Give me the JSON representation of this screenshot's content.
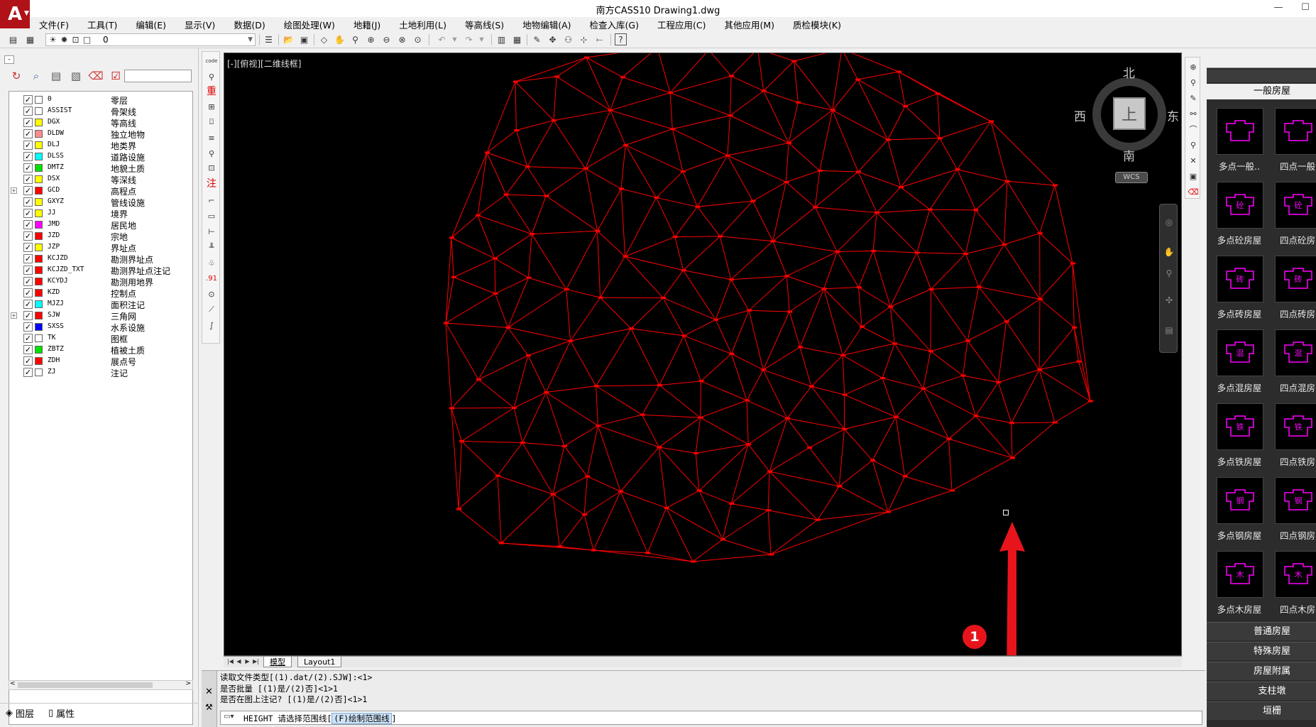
{
  "window": {
    "title": "南方CASS10    Drawing1.dwg",
    "minimize": "—",
    "maximize": "☐"
  },
  "menu": [
    "文件(F)",
    "工具(T)",
    "编辑(E)",
    "显示(V)",
    "数据(D)",
    "绘图处理(W)",
    "地籍(J)",
    "土地利用(L)",
    "等高线(S)",
    "地物编辑(A)",
    "检查入库(G)",
    "工程应用(C)",
    "其他应用(M)",
    "质检模块(K)"
  ],
  "toolbar": {
    "current_layer": "0"
  },
  "layers": [
    {
      "name": "0",
      "desc": "零层",
      "color": "#ffffff",
      "checked": true,
      "expandable": false
    },
    {
      "name": "ASSIST",
      "desc": "骨架线",
      "color": "#ffffff",
      "checked": true,
      "expandable": false
    },
    {
      "name": "DGX",
      "desc": "等高线",
      "color": "#ffff00",
      "checked": true,
      "expandable": false
    },
    {
      "name": "DLDW",
      "desc": "独立地物",
      "color": "#ff8c8c",
      "checked": true,
      "expandable": false
    },
    {
      "name": "DLJ",
      "desc": "地类界",
      "color": "#ffff00",
      "checked": true,
      "expandable": false
    },
    {
      "name": "DLSS",
      "desc": "道路设施",
      "color": "#00ffff",
      "checked": true,
      "expandable": false
    },
    {
      "name": "DMTZ",
      "desc": "地貌土质",
      "color": "#00e000",
      "checked": true,
      "expandable": false
    },
    {
      "name": "DSX",
      "desc": "等深线",
      "color": "#ffff00",
      "checked": true,
      "expandable": false
    },
    {
      "name": "GCD",
      "desc": "高程点",
      "color": "#ff0000",
      "checked": true,
      "expandable": true
    },
    {
      "name": "GXYZ",
      "desc": "管线设施",
      "color": "#ffff00",
      "checked": true,
      "expandable": false
    },
    {
      "name": "JJ",
      "desc": "境界",
      "color": "#ffff00",
      "checked": true,
      "expandable": false
    },
    {
      "name": "JMD",
      "desc": "居民地",
      "color": "#ff00ff",
      "checked": true,
      "expandable": false
    },
    {
      "name": "JZD",
      "desc": "宗地",
      "color": "#ff0000",
      "checked": true,
      "expandable": false
    },
    {
      "name": "JZP",
      "desc": "界址点",
      "color": "#ffff00",
      "checked": true,
      "expandable": false
    },
    {
      "name": "KCJZD",
      "desc": "勘测界址点",
      "color": "#ff0000",
      "checked": true,
      "expandable": false
    },
    {
      "name": "KCJZD_TXT",
      "desc": "勘测界址点注记",
      "color": "#ff0000",
      "checked": true,
      "expandable": false
    },
    {
      "name": "KCYDJ",
      "desc": "勘测用地界",
      "color": "#ff0000",
      "checked": true,
      "expandable": false
    },
    {
      "name": "KZD",
      "desc": "控制点",
      "color": "#ff0000",
      "checked": true,
      "expandable": false
    },
    {
      "name": "MJZJ",
      "desc": "面积注记",
      "color": "#00ffff",
      "checked": true,
      "expandable": false
    },
    {
      "name": "SJW",
      "desc": "三角网",
      "color": "#ff0000",
      "checked": true,
      "expandable": true
    },
    {
      "name": "SXSS",
      "desc": "水系设施",
      "color": "#0000ff",
      "checked": true,
      "expandable": false
    },
    {
      "name": "TK",
      "desc": "图框",
      "color": "#ffffff",
      "checked": true,
      "expandable": false
    },
    {
      "name": "ZBTZ",
      "desc": "植被土质",
      "color": "#00e000",
      "checked": true,
      "expandable": false
    },
    {
      "name": "ZDH",
      "desc": "展点号",
      "color": "#ff0000",
      "checked": true,
      "expandable": false
    },
    {
      "name": "ZJ",
      "desc": "注记",
      "color": "#ffffff",
      "checked": true,
      "expandable": false
    }
  ],
  "panel_tabs": {
    "layers": "图层",
    "properties": "属性"
  },
  "drawing": {
    "view_label": "[-][俯视][二维线框]",
    "tin_color": "#ff0000",
    "viewcube": {
      "north": "北",
      "south": "南",
      "east": "东",
      "west": "西",
      "top": "上",
      "wcs": "WCS"
    },
    "step_badge": "1"
  },
  "layout_tabs": [
    "模型",
    "Layout1"
  ],
  "palette": {
    "category": "一般房屋",
    "tiles": [
      {
        "label": "多点一般..",
        "glyph": ""
      },
      {
        "label": "四点一般",
        "glyph": ""
      },
      {
        "label": "多点砼房屋",
        "glyph": "砼"
      },
      {
        "label": "四点砼房",
        "glyph": "砼"
      },
      {
        "label": "多点砖房屋",
        "glyph": "砖"
      },
      {
        "label": "四点砖房",
        "glyph": "砖"
      },
      {
        "label": "多点混房屋",
        "glyph": "混"
      },
      {
        "label": "四点混房",
        "glyph": "混"
      },
      {
        "label": "多点铁房屋",
        "glyph": "铁"
      },
      {
        "label": "四点铁房",
        "glyph": "铁"
      },
      {
        "label": "多点钢房屋",
        "glyph": "钢"
      },
      {
        "label": "四点钢房",
        "glyph": "钢"
      },
      {
        "label": "多点木房屋",
        "glyph": "木"
      },
      {
        "label": "四点木房",
        "glyph": "木"
      }
    ],
    "categories": [
      "普通房屋",
      "特殊房屋",
      "房屋附属",
      "支柱墩",
      "垣栅"
    ]
  },
  "command": {
    "history": [
      "读取文件类型[(1).dat/(2).SJW]:<1>",
      "是否批量 [(1)是/(2)否]<1>1",
      "是否在图上注记? [(1)是/(2)否]<1>1"
    ],
    "prompt_cmd": "HEIGHT 请选择范围线[",
    "prompt_option": "(F)绘制范围线",
    "prompt_end": "]"
  }
}
